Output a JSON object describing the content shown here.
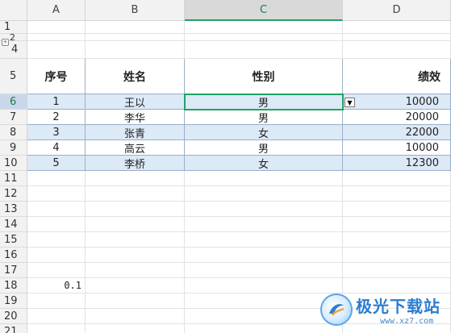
{
  "columns": [
    "A",
    "B",
    "C",
    "D"
  ],
  "rows": [
    "1",
    "2",
    "4",
    "5",
    "6",
    "7",
    "8",
    "9",
    "10",
    "11",
    "12",
    "13",
    "14",
    "15",
    "16",
    "17",
    "18",
    "19",
    "20",
    "21"
  ],
  "outline_toggle": "÷",
  "table": {
    "headers": [
      "序号",
      "姓名",
      "性别",
      "绩效"
    ],
    "records": [
      [
        "1",
        "王以",
        "男",
        "10000"
      ],
      [
        "2",
        "李华",
        "男",
        "20000"
      ],
      [
        "3",
        "张青",
        "女",
        "22000"
      ],
      [
        "4",
        "高云",
        "男",
        "10000"
      ],
      [
        "5",
        "李桥",
        "女",
        "12300"
      ]
    ]
  },
  "a18_value": "0.1",
  "active_cell": "C6",
  "dropdown_arrow": "▼",
  "colors": {
    "accent": "#21a366",
    "band": "#dce9f6",
    "header_bg": "#f2f2f2"
  },
  "watermark": {
    "text": "极光下载站",
    "url": "www.xz7.com"
  }
}
